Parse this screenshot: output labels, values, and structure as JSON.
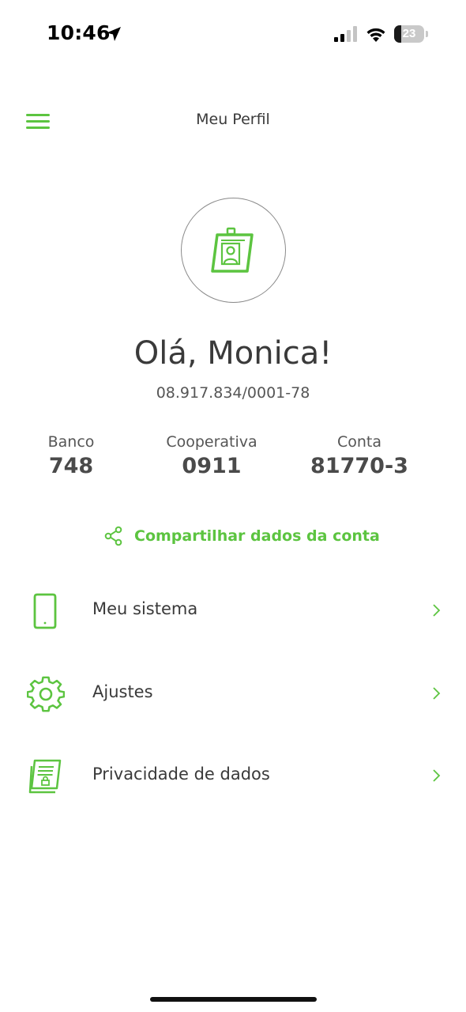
{
  "status_bar": {
    "time": "10:46",
    "battery_level": "23",
    "icons": [
      "location-arrow-icon",
      "signal-icon",
      "wifi-icon",
      "battery-icon"
    ]
  },
  "header": {
    "title": "Meu Perfil",
    "menu_icon": "hamburger-menu-icon"
  },
  "profile": {
    "avatar_icon": "id-badge-icon",
    "greeting": "Olá, Monica!",
    "document": "08.917.834/0001-78"
  },
  "account": {
    "banco": {
      "label": "Banco",
      "value": "748"
    },
    "cooperativa": {
      "label": "Cooperativa",
      "value": "0911"
    },
    "conta": {
      "label": "Conta",
      "value": "81770-3"
    }
  },
  "share": {
    "label": "Compartilhar dados da conta",
    "icon": "share-icon"
  },
  "menu_items": [
    {
      "label": "Meu sistema",
      "icon": "smartphone-icon"
    },
    {
      "label": "Ajustes",
      "icon": "gear-icon"
    },
    {
      "label": "Privacidade de dados",
      "icon": "privacy-document-icon"
    }
  ],
  "colors": {
    "accent": "#5cc440",
    "text": "#3a3a3a",
    "background": "#ffffff"
  }
}
